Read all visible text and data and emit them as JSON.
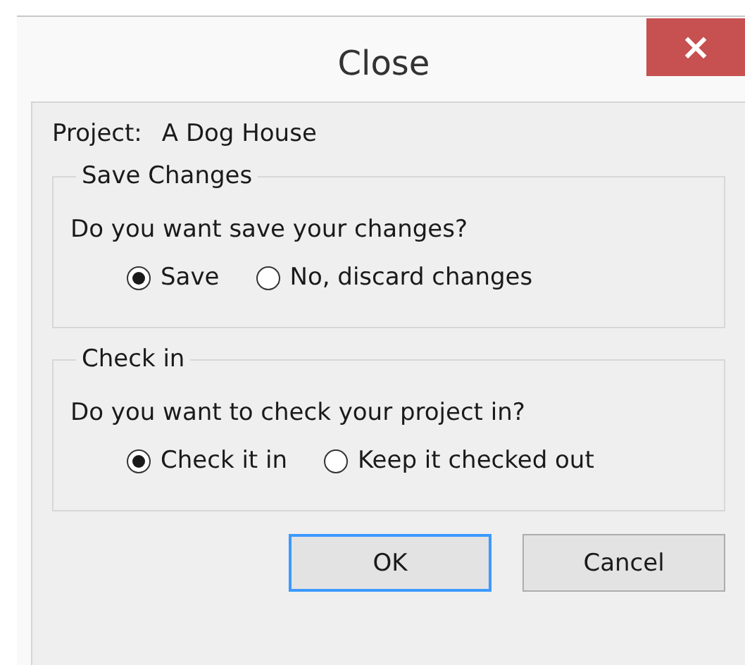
{
  "window": {
    "title": "Close",
    "close_glyph": "×"
  },
  "project": {
    "label": "Project:",
    "value": "A Dog House"
  },
  "groups": [
    {
      "title": "Save Changes",
      "question": "Do you want save your changes?",
      "options": [
        {
          "label": "Save",
          "selected": true
        },
        {
          "label": "No, discard changes",
          "selected": false
        }
      ]
    },
    {
      "title": "Check in",
      "question": "Do you want to check your project in?",
      "options": [
        {
          "label": "Check it in",
          "selected": true
        },
        {
          "label": "Keep it checked out",
          "selected": false
        }
      ]
    }
  ],
  "buttons": [
    {
      "label": "OK",
      "default": true
    },
    {
      "label": "Cancel",
      "default": false
    }
  ]
}
